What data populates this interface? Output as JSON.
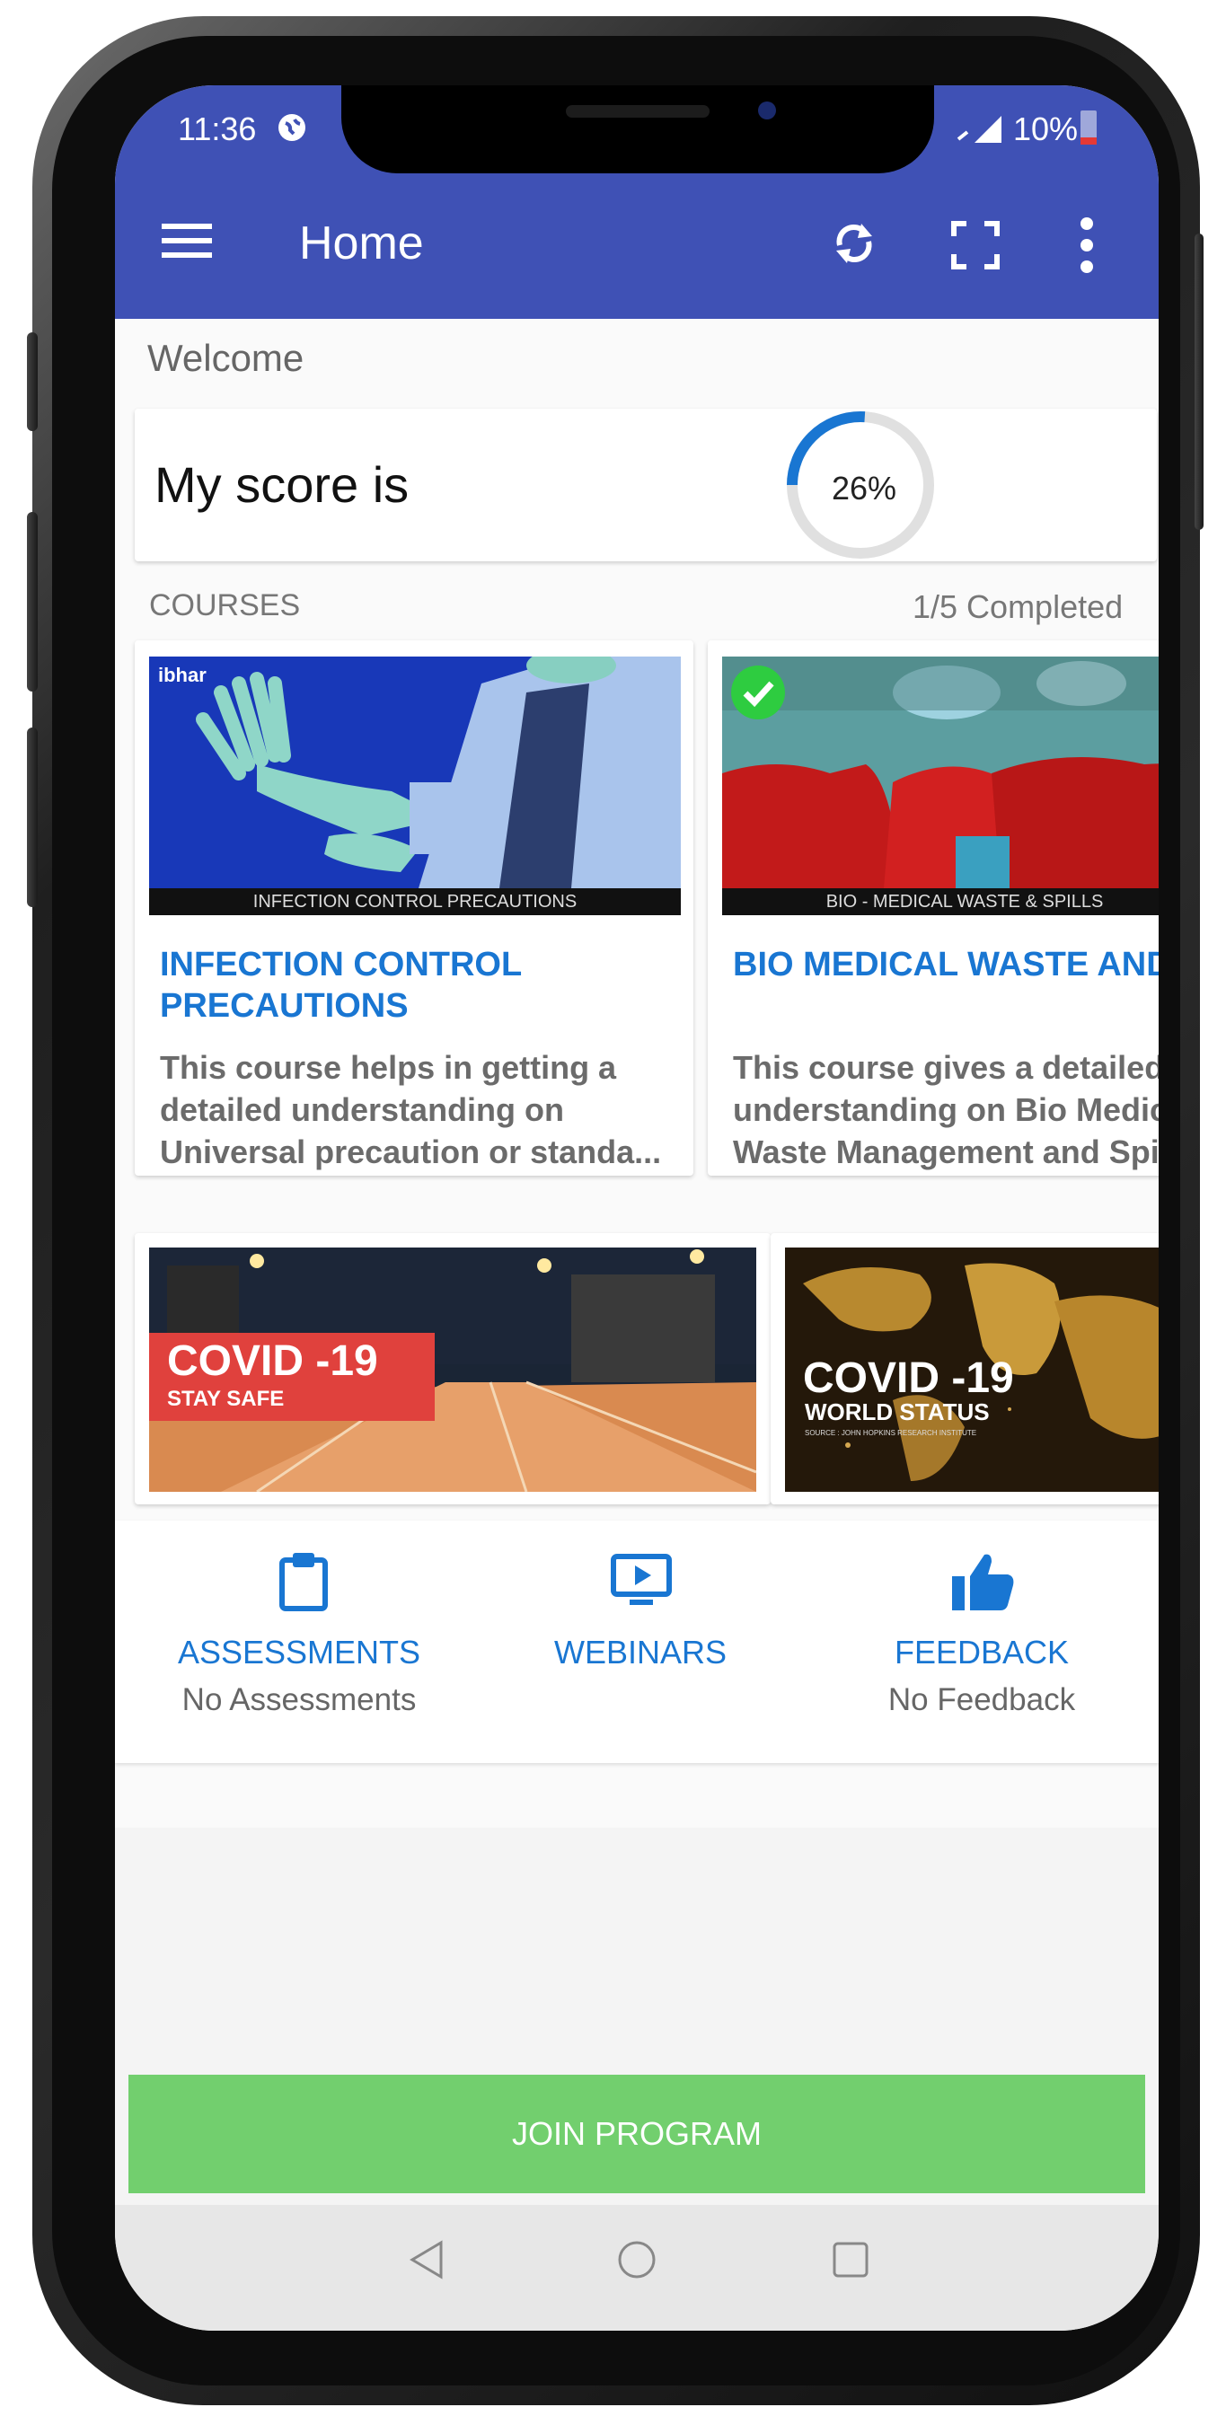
{
  "status_bar": {
    "time": "11:36",
    "battery": "10%"
  },
  "app_bar": {
    "title": "Home"
  },
  "welcome": "Welcome",
  "score": {
    "label": "My score is",
    "percent_text": "26%",
    "percent": 26
  },
  "courses": {
    "header": "COURSES",
    "completed": "1/5 Completed",
    "items": [
      {
        "brand": "ibhar",
        "caption": "INFECTION CONTROL PRECAUTIONS",
        "title": "INFECTION CONTROL PRECAUTIONS",
        "description": "This course helps in getting a detailed understanding on Universal precaution or standa..."
      },
      {
        "caption": "BIO - MEDICAL WASTE & SPILLS",
        "title": "BIO MEDICAL WASTE AND SPILLS",
        "description": "This course gives a detailed understanding on Bio Medical Waste Management and Spills"
      }
    ]
  },
  "banners": [
    {
      "title": "COVID -19",
      "subtitle": "STAY SAFE"
    },
    {
      "title": "COVID -19",
      "subtitle": "WORLD STATUS",
      "source": "SOURCE : JOHN HOPKINS RESEARCH INSTITUTE"
    }
  ],
  "tiles": [
    {
      "icon": "clipboard-icon",
      "label": "ASSESSMENTS",
      "sub": "No Assessments"
    },
    {
      "icon": "monitor-play-icon",
      "label": "WEBINARS",
      "sub": ""
    },
    {
      "icon": "thumbs-up-icon",
      "label": "FEEDBACK",
      "sub": "No Feedback"
    }
  ],
  "join_button": "JOIN PROGRAM",
  "colors": {
    "primary": "#3f51b5",
    "accent": "#1976d2",
    "join": "#72cf6e",
    "check": "#2ecc40"
  }
}
